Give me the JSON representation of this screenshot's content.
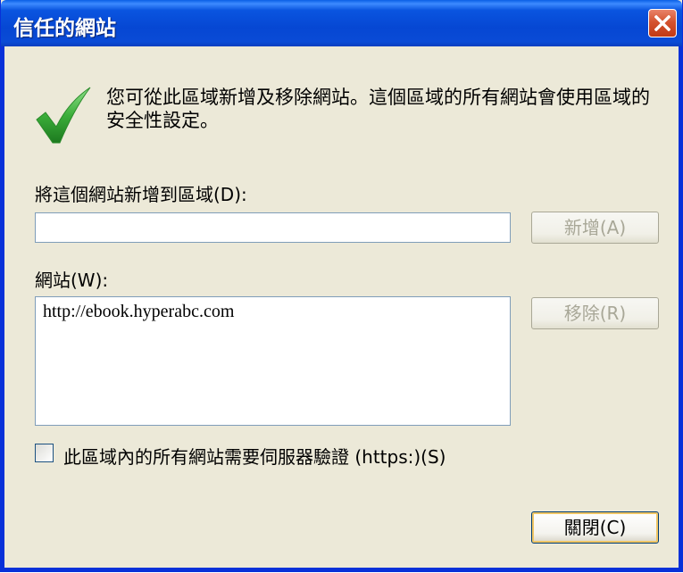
{
  "window": {
    "title": "信任的網站"
  },
  "intro": {
    "text": "您可從此區域新增及移除網站。這個區域的所有網站會使用區域的安全性設定。",
    "icon": "checkmark-icon"
  },
  "add_section": {
    "label": "將這個網站新增到區域(D):",
    "input_value": "",
    "add_button": "新增(A)"
  },
  "sites_section": {
    "label": "網站(W):",
    "sites": [
      "http://ebook.hyperabc.com"
    ],
    "remove_button": "移除(R)"
  },
  "require_https": {
    "checked": false,
    "label": "此區域內的所有網站需要伺服器驗證 (https:)(S)"
  },
  "footer": {
    "close_button": "關閉(C)"
  },
  "colors": {
    "titlebar": "#0a55e0",
    "dialog_bg": "#ece9d8",
    "close_red": "#d4532f",
    "check_green": "#3cae3a"
  }
}
